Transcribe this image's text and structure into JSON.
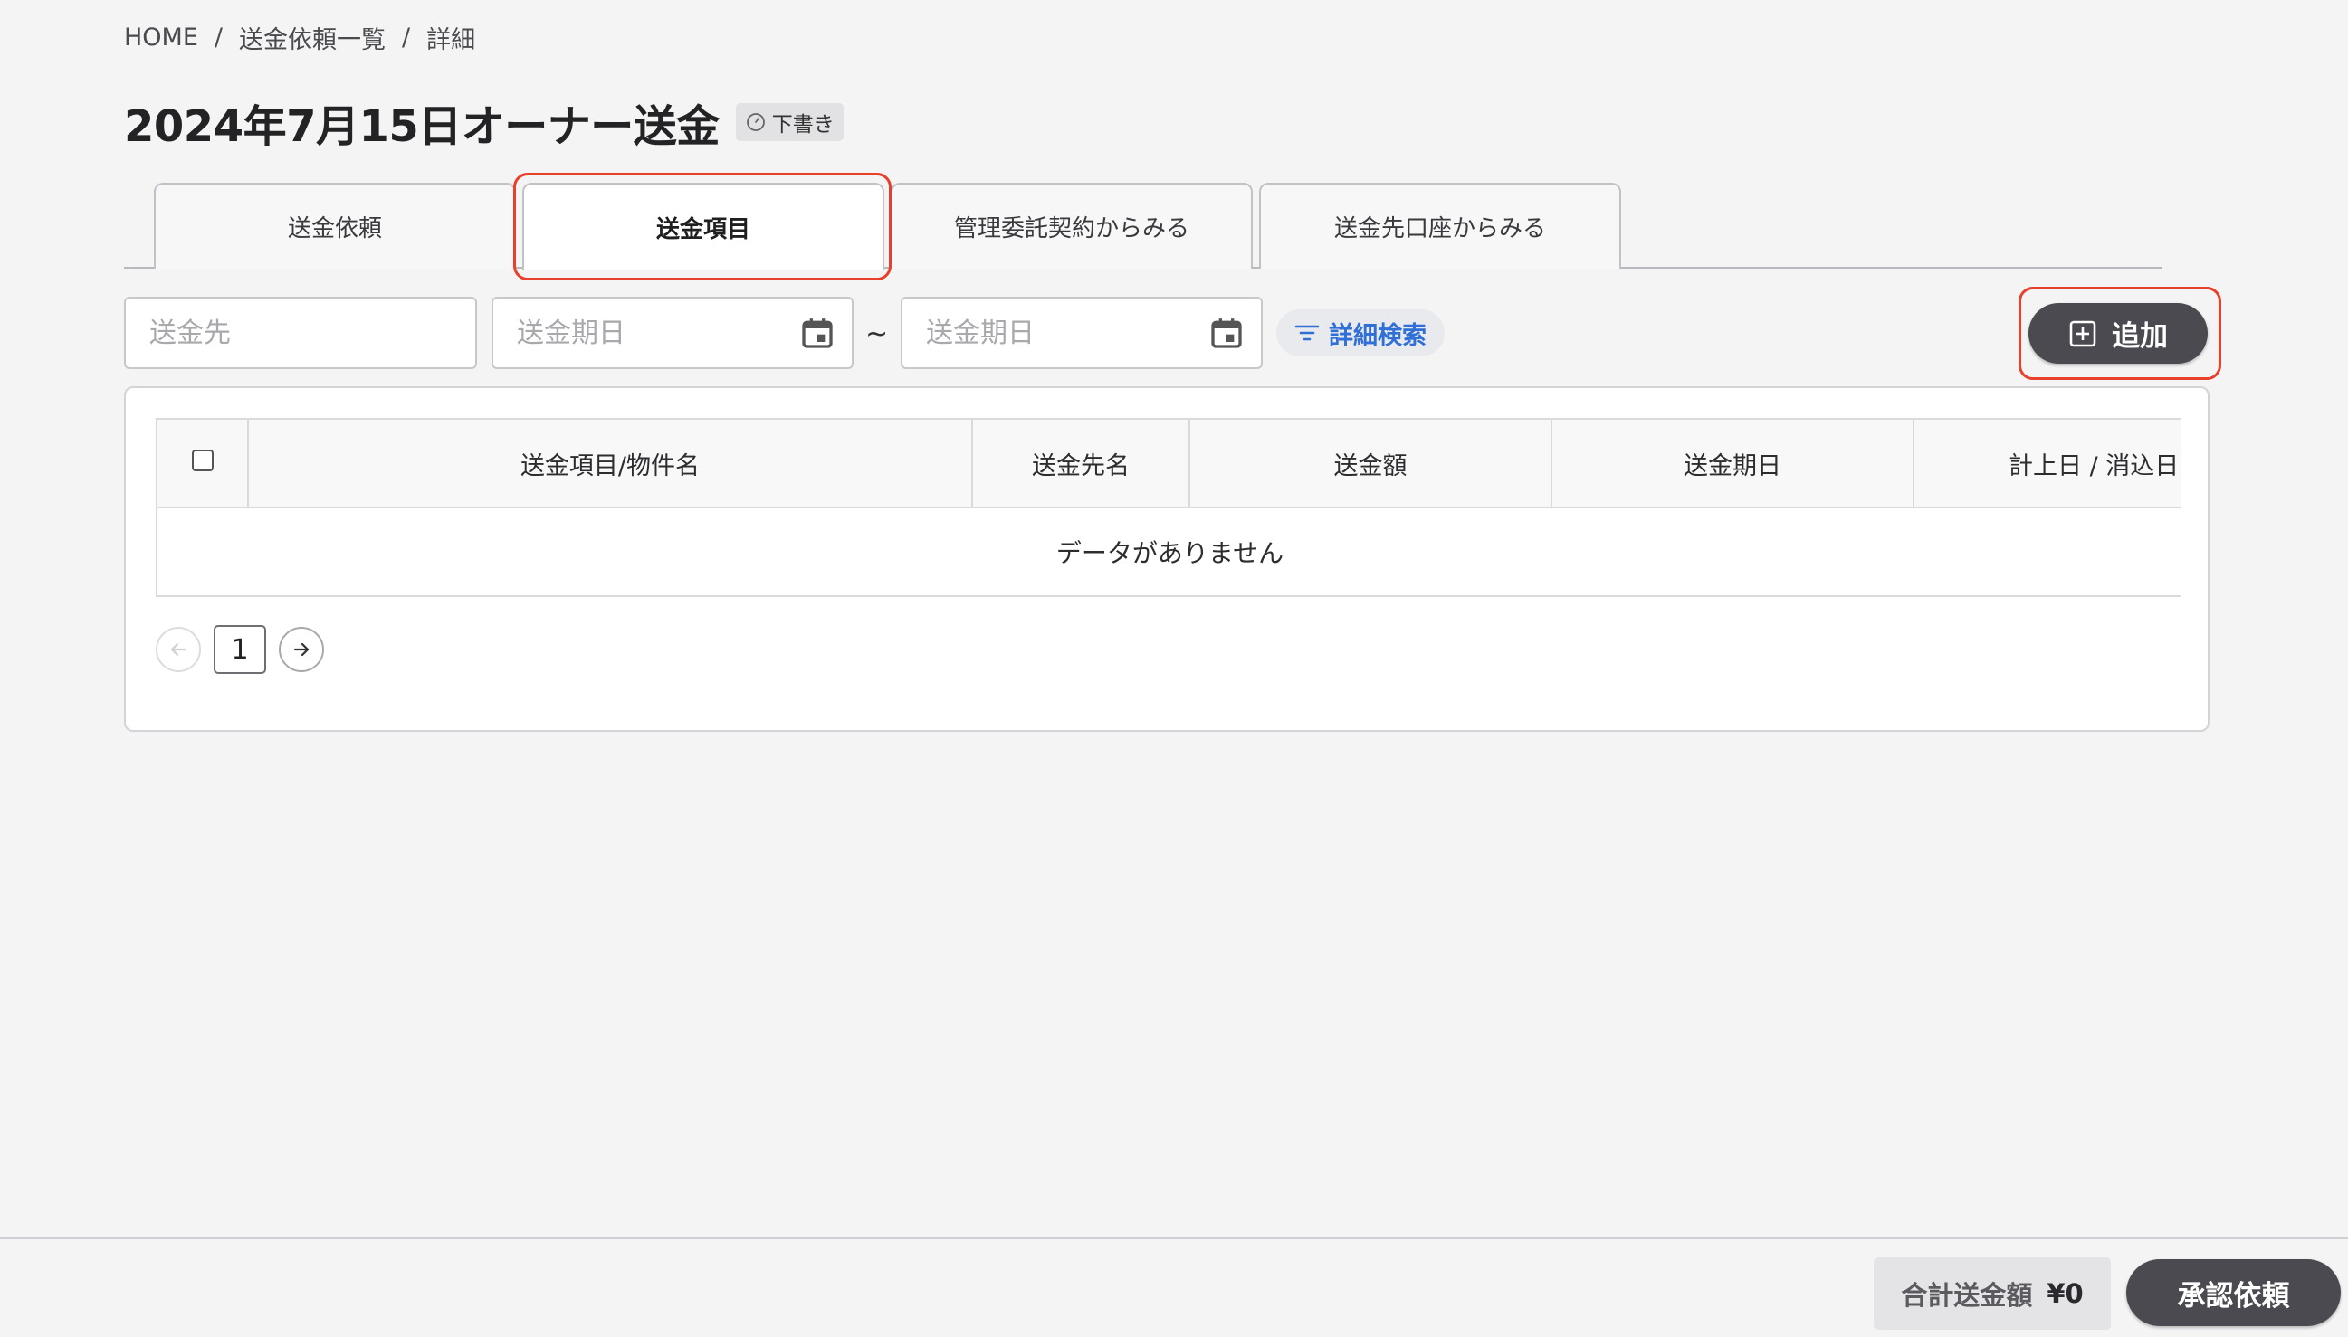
{
  "breadcrumb": {
    "home": "HOME",
    "sep": "/",
    "list": "送金依頼一覧",
    "current": "詳細"
  },
  "header": {
    "title": "2024年7月15日オーナー送金",
    "status_badge": "下書き"
  },
  "tabs": [
    {
      "label": "送金依頼",
      "active": false
    },
    {
      "label": "送金項目",
      "active": true
    },
    {
      "label": "管理委託契約からみる",
      "active": false
    },
    {
      "label": "送金先口座からみる",
      "active": false
    }
  ],
  "filters": {
    "recipient_placeholder": "送金先",
    "date_from_placeholder": "送金期日",
    "date_to_placeholder": "送金期日",
    "range_separator": "~",
    "detail_search_label": "詳細検索"
  },
  "add_button_label": "追加",
  "table": {
    "columns": [
      "送金項目/物件名",
      "送金先名",
      "送金額",
      "送金期日",
      "計上日 / 消込日"
    ],
    "empty_message": "データがありません"
  },
  "pagination": {
    "current_page": "1"
  },
  "footer": {
    "total_label": "合計送金額",
    "total_amount": "¥0",
    "approve_label": "承認依頼"
  },
  "colors": {
    "highlight": "#e8402b",
    "primary_button": "#4a4a50",
    "link_blue": "#2f6fd6"
  }
}
